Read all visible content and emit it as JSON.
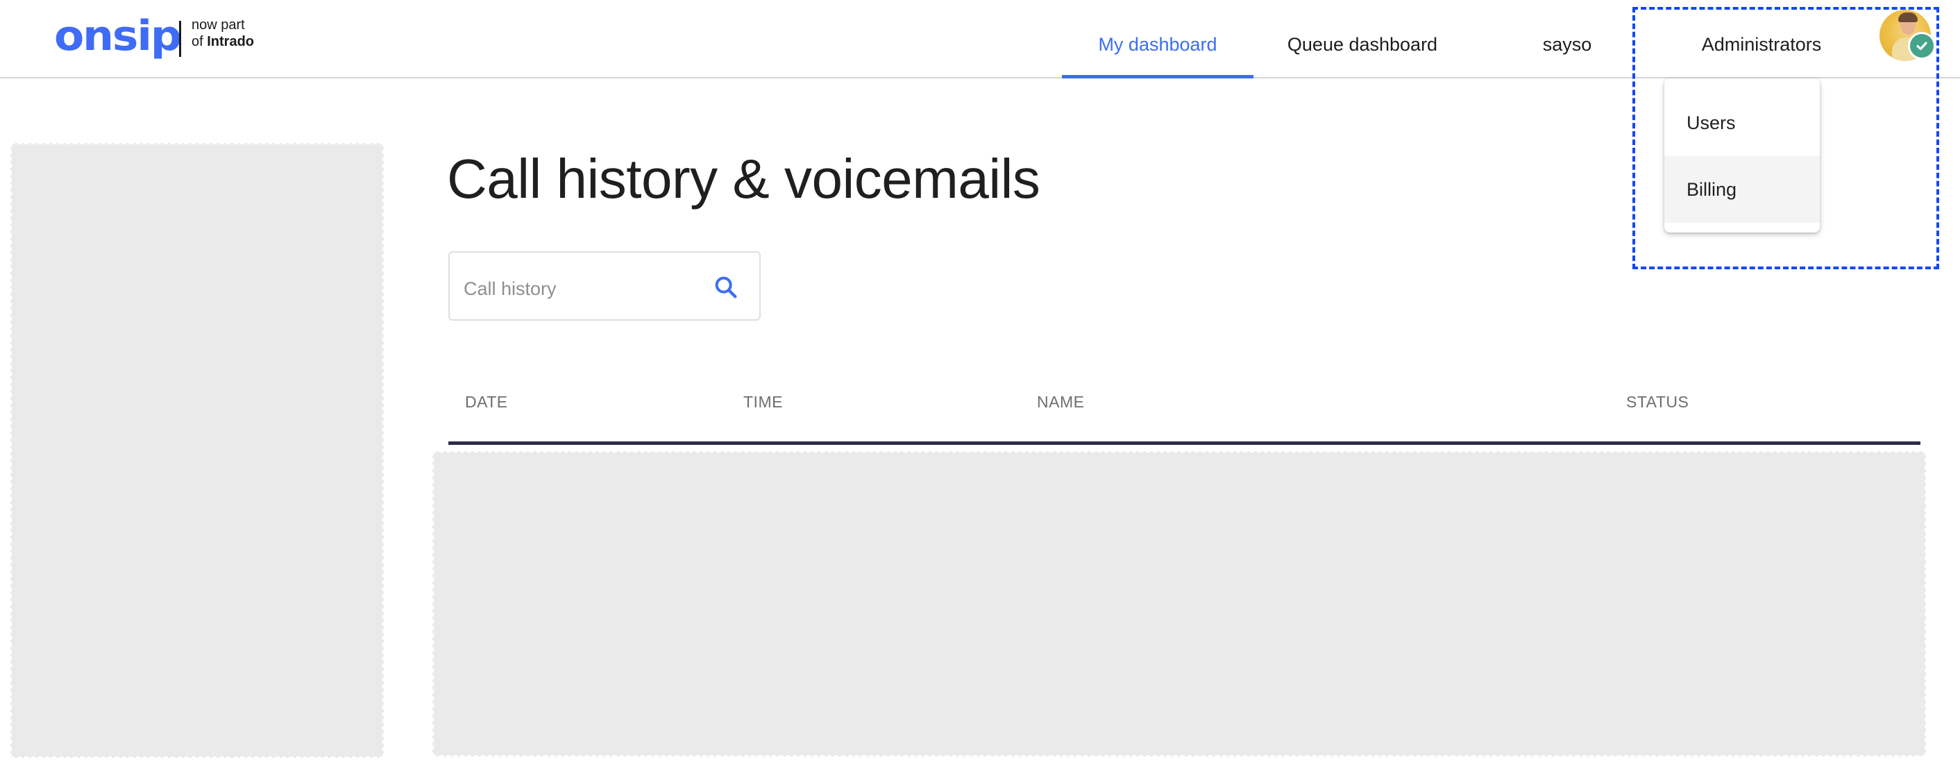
{
  "brand": {
    "logo_text": "onsip",
    "tagline_line1": "now part",
    "tagline_line2_prefix": "of",
    "tagline_line2_bold": "Intrado",
    "color": "#3f6cf5"
  },
  "nav": {
    "items": [
      {
        "label": "My dashboard",
        "active": true
      },
      {
        "label": "Queue dashboard",
        "active": false
      },
      {
        "label": "sayso",
        "active": false
      },
      {
        "label": "Administrators",
        "active": false
      }
    ],
    "active_color": "#3f6cf5"
  },
  "user": {
    "avatar_icon": "user-avatar-photo",
    "status_icon": "check-icon",
    "status_color": "#45a38a"
  },
  "admin_menu": {
    "items": [
      {
        "label": "Users",
        "highlighted": false
      },
      {
        "label": "Billing",
        "highlighted": true
      }
    ]
  },
  "page": {
    "title": "Call history & voicemails"
  },
  "search": {
    "placeholder": "Call history",
    "value": "",
    "icon": "search-icon"
  },
  "table": {
    "columns": [
      "DATE",
      "TIME",
      "NAME",
      "STATUS"
    ],
    "rule_color": "#2e2d4a"
  }
}
